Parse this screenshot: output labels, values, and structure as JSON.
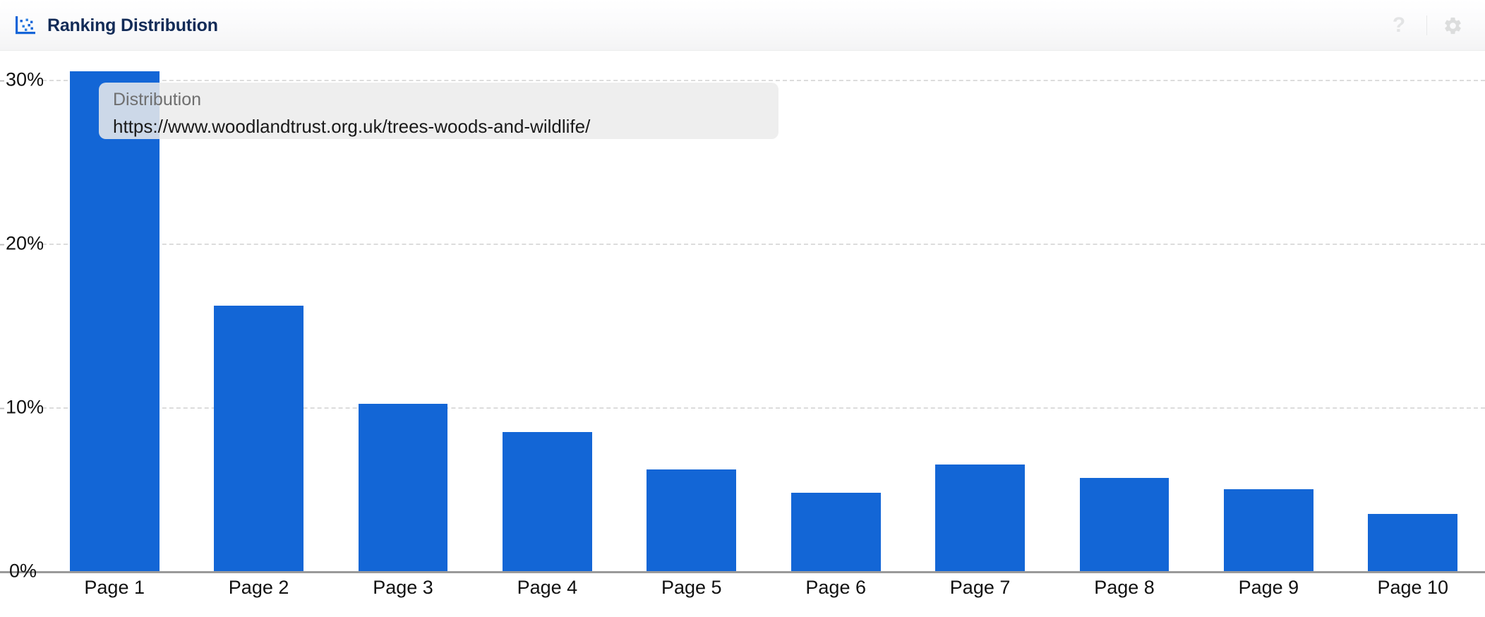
{
  "header": {
    "title": "Ranking Distribution",
    "icon": "scatter-chart-icon",
    "help_label": "?",
    "settings_icon": "gear-icon",
    "title_color": "#122b57"
  },
  "tooltip": {
    "title": "Distribution",
    "url": "https://www.woodlandtrust.org.uk/trees-woods-and-wildlife/"
  },
  "chart_data": {
    "type": "bar",
    "title": "Ranking Distribution",
    "xlabel": "",
    "ylabel": "",
    "categories": [
      "Page 1",
      "Page 2",
      "Page 3",
      "Page 4",
      "Page 5",
      "Page 6",
      "Page 7",
      "Page 8",
      "Page 9",
      "Page 10"
    ],
    "values": [
      30.5,
      16.2,
      10.2,
      8.5,
      6.2,
      4.8,
      6.5,
      5.7,
      5.0,
      3.5
    ],
    "ylim": [
      0,
      31.8
    ],
    "ytick_labels": [
      "30%",
      "20%",
      "10%",
      "0%"
    ],
    "ytick_values": [
      30,
      20,
      10,
      0
    ],
    "grid": true,
    "grid_style": "dashed-horizontal",
    "legend": false,
    "bar_color": "#1366d6"
  }
}
